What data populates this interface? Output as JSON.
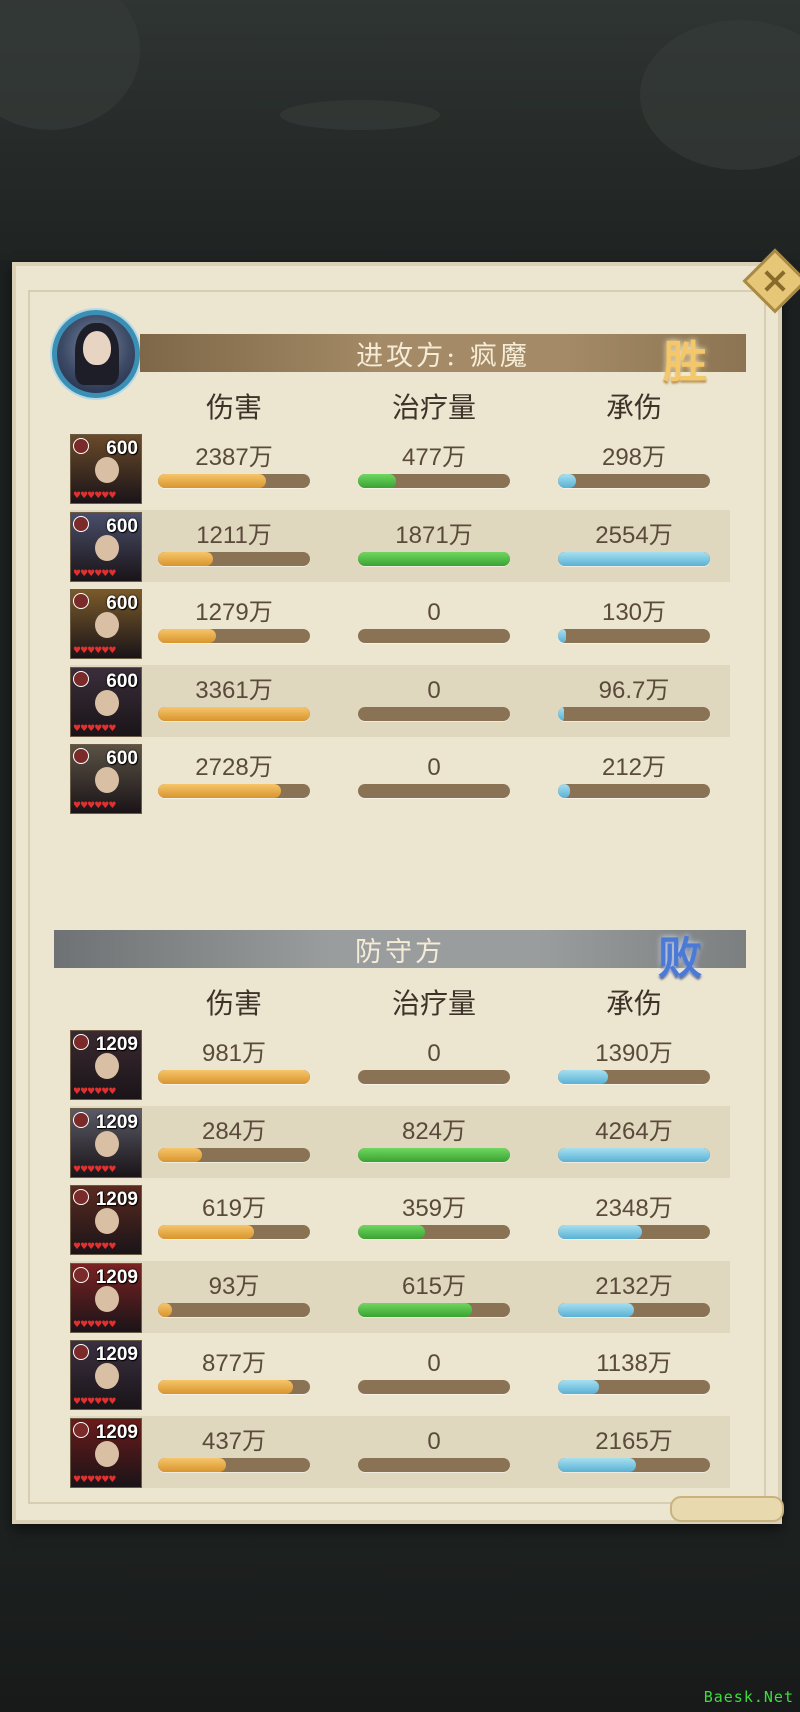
{
  "attacker": {
    "banner": "进攻方: 疯魔",
    "result": "胜",
    "headers": [
      "伤害",
      "治疗量",
      "承伤"
    ],
    "rows": [
      {
        "level": "600",
        "damage": "2387万",
        "heal": "477万",
        "taken": "298万",
        "damage_fill": 0.71,
        "heal_fill": 0.25,
        "taken_fill": 0.12
      },
      {
        "level": "600",
        "damage": "1211万",
        "heal": "1871万",
        "taken": "2554万",
        "damage_fill": 0.36,
        "heal_fill": 1.0,
        "taken_fill": 1.0
      },
      {
        "level": "600",
        "damage": "1279万",
        "heal": "0",
        "taken": "130万",
        "damage_fill": 0.38,
        "heal_fill": 0,
        "taken_fill": 0.05
      },
      {
        "level": "600",
        "damage": "3361万",
        "heal": "0",
        "taken": "96.7万",
        "damage_fill": 1.0,
        "heal_fill": 0,
        "taken_fill": 0.04
      },
      {
        "level": "600",
        "damage": "2728万",
        "heal": "0",
        "taken": "212万",
        "damage_fill": 0.81,
        "heal_fill": 0,
        "taken_fill": 0.08
      }
    ]
  },
  "defender": {
    "banner": "防守方",
    "result": "败",
    "headers": [
      "伤害",
      "治疗量",
      "承伤"
    ],
    "rows": [
      {
        "level": "1209",
        "damage": "981万",
        "heal": "0",
        "taken": "1390万",
        "damage_fill": 1.0,
        "heal_fill": 0,
        "taken_fill": 0.33
      },
      {
        "level": "1209",
        "damage": "284万",
        "heal": "824万",
        "taken": "4264万",
        "damage_fill": 0.29,
        "heal_fill": 1.0,
        "taken_fill": 1.0
      },
      {
        "level": "1209",
        "damage": "619万",
        "heal": "359万",
        "taken": "2348万",
        "damage_fill": 0.63,
        "heal_fill": 0.44,
        "taken_fill": 0.55
      },
      {
        "level": "1209",
        "damage": "93万",
        "heal": "615万",
        "taken": "2132万",
        "damage_fill": 0.09,
        "heal_fill": 0.75,
        "taken_fill": 0.5
      },
      {
        "level": "1209",
        "damage": "877万",
        "heal": "0",
        "taken": "1138万",
        "damage_fill": 0.89,
        "heal_fill": 0,
        "taken_fill": 0.27
      },
      {
        "level": "1209",
        "damage": "437万",
        "heal": "0",
        "taken": "2165万",
        "damage_fill": 0.45,
        "heal_fill": 0,
        "taken_fill": 0.51
      }
    ]
  },
  "watermark": "Baesk.Net",
  "colors": {
    "damage": "#e0a03a",
    "heal": "#4cba3f",
    "taken": "#6cc0e0",
    "track": "#8a7355"
  }
}
